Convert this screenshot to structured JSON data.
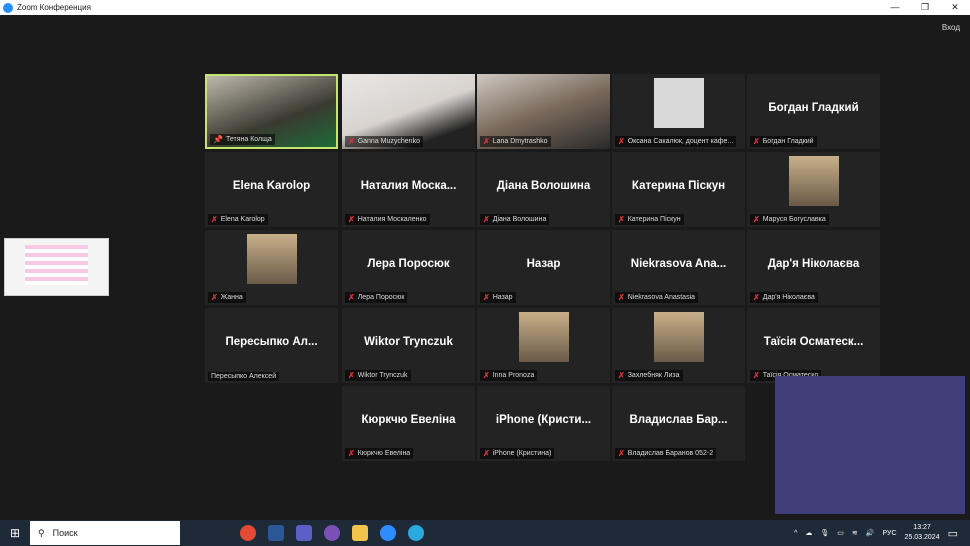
{
  "window": {
    "title": "Zoom Конференция",
    "logo": "zm",
    "minimize": "—",
    "maximize": "❐",
    "close": "✕"
  },
  "header": {
    "enter_label": "Вход"
  },
  "tiles": [
    {
      "caption": "Тетяна Колща",
      "big": "",
      "type": "video",
      "pinned": true,
      "active": true
    },
    {
      "caption": "Ganna Muzychenko",
      "big": "",
      "type": "video"
    },
    {
      "caption": "Lana Dmytrashko",
      "big": "",
      "type": "video"
    },
    {
      "caption": "Оксана Сакалюк, доцент кафе...",
      "big": "",
      "type": "avatar"
    },
    {
      "caption": "Богдан Гладкий",
      "big": "Богдан Гладкий"
    },
    {
      "caption": "Elena Karolop",
      "big": "Elena Karolop"
    },
    {
      "caption": "Наталия Москаленко",
      "big": "Наталия  Моска..."
    },
    {
      "caption": "Діана Волошина",
      "big": "Діана Волошина"
    },
    {
      "caption": "Катерина Піскун",
      "big": "Катерина Піскун"
    },
    {
      "caption": "Маруся Богуславка",
      "big": "",
      "type": "avatar"
    },
    {
      "caption": "Жанна",
      "big": "",
      "type": "avatar"
    },
    {
      "caption": "Лера Поросюк",
      "big": "Лера Поросюк"
    },
    {
      "caption": "Назар",
      "big": "Назар"
    },
    {
      "caption": "Niekrasova Anastasia",
      "big": "Niekrasova  Ana..."
    },
    {
      "caption": "Дар'я Ніколаєва",
      "big": "Дар'я Ніколаєва"
    },
    {
      "caption": "Пересыпко Алексей",
      "big": "Пересыпко  Ал...",
      "nomic": true
    },
    {
      "caption": "Wiktor Trynczuk",
      "big": "Wiktor Trynczuk"
    },
    {
      "caption": "Inna Pronoza",
      "big": "",
      "type": "avatar"
    },
    {
      "caption": "Захлебняк Лиза",
      "big": "",
      "type": "avatar"
    },
    {
      "caption": "Таїсія Осматеско",
      "big": "Таїсія  Осматеск..."
    },
    {
      "caption": "Кюркчю Евеліна",
      "big": "Кюркчю Евеліна"
    },
    {
      "caption": "iPhone (Кристина)",
      "big": "iPhone  (Кристи..."
    },
    {
      "caption": "Владислав Баранов 052-2",
      "big": "Владислав  Бар..."
    }
  ],
  "taskbar": {
    "search_placeholder": "Поиск",
    "lang": "РУС",
    "time": "13:27",
    "date": "25.03.2024"
  },
  "colors": {
    "accent": "#c6e36b",
    "muted": "#e0313c",
    "selfview": "#3f3d7a"
  }
}
